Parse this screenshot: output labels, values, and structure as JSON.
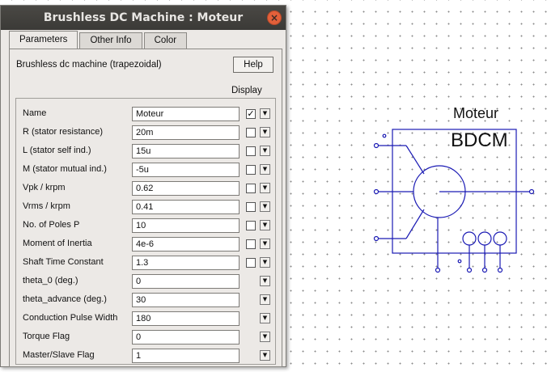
{
  "window": {
    "title": "Brushless DC Machine : Moteur",
    "close_glyph": "×"
  },
  "tabs": [
    {
      "label": "Parameters",
      "active": true
    },
    {
      "label": "Other Info",
      "active": false
    },
    {
      "label": "Color",
      "active": false
    }
  ],
  "panel": {
    "subtitle": "Brushless dc machine (trapezoidal)",
    "help_label": "Help",
    "display_label": "Display"
  },
  "params": [
    {
      "label": "Name",
      "value": "Moteur",
      "display": true,
      "has_checkbox": true
    },
    {
      "label": "R (stator resistance)",
      "value": "20m",
      "display": false,
      "has_checkbox": true
    },
    {
      "label": "L (stator self ind.)",
      "value": "15u",
      "display": false,
      "has_checkbox": true
    },
    {
      "label": "M (stator mutual ind.)",
      "value": "-5u",
      "display": false,
      "has_checkbox": true
    },
    {
      "label": "Vpk / krpm",
      "value": "0.62",
      "display": false,
      "has_checkbox": true
    },
    {
      "label": "Vrms / krpm",
      "value": "0.41",
      "display": false,
      "has_checkbox": true
    },
    {
      "label": "No. of Poles P",
      "value": "10",
      "display": false,
      "has_checkbox": true
    },
    {
      "label": "Moment of Inertia",
      "value": "4e-6",
      "display": false,
      "has_checkbox": true
    },
    {
      "label": "Shaft Time Constant",
      "value": "1.3",
      "display": false,
      "has_checkbox": true
    },
    {
      "label": "theta_0 (deg.)",
      "value": "0",
      "display": false,
      "has_checkbox": false
    },
    {
      "label": "theta_advance (deg.)",
      "value": "30",
      "display": false,
      "has_checkbox": false
    },
    {
      "label": "Conduction Pulse Width",
      "value": "180",
      "display": false,
      "has_checkbox": false
    },
    {
      "label": "Torque Flag",
      "value": "0",
      "display": false,
      "has_checkbox": false
    },
    {
      "label": "Master/Slave Flag",
      "value": "1",
      "display": false,
      "has_checkbox": false
    }
  ],
  "component": {
    "name": "Moteur",
    "type_label": "BDCM",
    "line_color": "#1a1ab4"
  },
  "icons": {
    "check": "✓",
    "dropdown": "▼"
  }
}
